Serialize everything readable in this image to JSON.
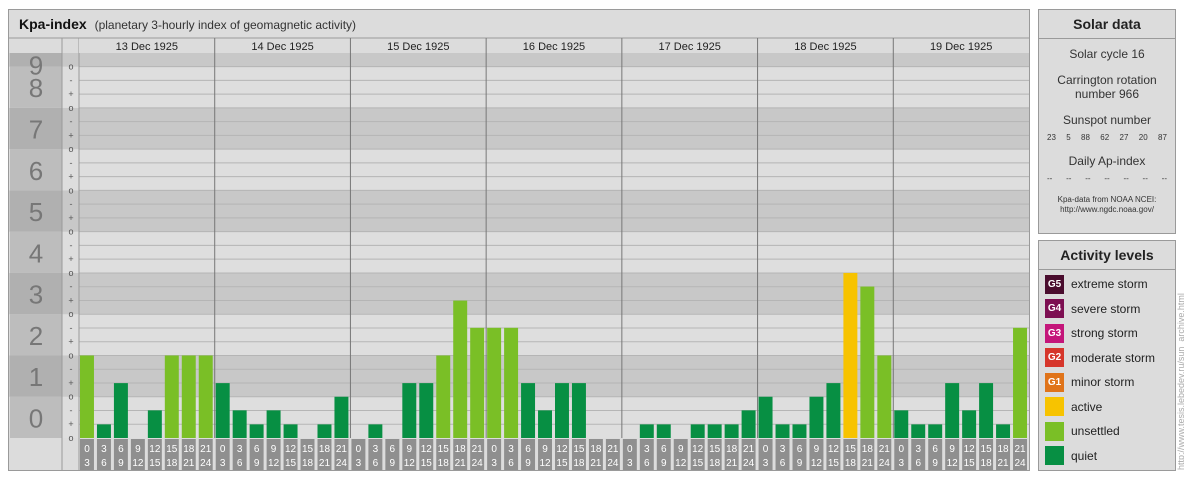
{
  "header": {
    "title": "Kpa-index",
    "subtitle": "(planetary 3-hourly index of geomagnetic activity)"
  },
  "chart_data": {
    "type": "bar",
    "title": "Kpa-index",
    "subtitle": "(planetary 3-hourly index of geomagnetic activity)",
    "days": [
      "13 Dec 1925",
      "14 Dec 1925",
      "15 Dec 1925",
      "16 Dec 1925",
      "17 Dec 1925",
      "18 Dec 1925",
      "19 Dec 1925"
    ],
    "interval_top": [
      "0",
      "3",
      "6",
      "9",
      "12",
      "15",
      "18",
      "21"
    ],
    "interval_bottom": [
      "3",
      "6",
      "9",
      "12",
      "15",
      "18",
      "21",
      "24"
    ],
    "y_major_ticks": [
      "0",
      "1",
      "2",
      "3",
      "4",
      "5",
      "6",
      "7",
      "8",
      "9"
    ],
    "y_minor_ticks": [
      "-",
      "o",
      "+"
    ],
    "ylim": [
      0,
      9.33
    ],
    "values": [
      [
        2.0,
        0.33,
        1.33,
        0.0,
        0.67,
        2.0,
        2.0,
        2.0
      ],
      [
        1.33,
        0.67,
        0.33,
        0.67,
        0.33,
        0.0,
        0.33,
        1.0
      ],
      [
        0.0,
        0.33,
        0.0,
        1.33,
        1.33,
        2.0,
        3.33,
        2.67
      ],
      [
        2.67,
        2.67,
        1.33,
        0.67,
        1.33,
        1.33,
        0.0,
        0.0
      ],
      [
        0.0,
        0.33,
        0.33,
        0.0,
        0.33,
        0.33,
        0.33,
        0.67
      ],
      [
        1.0,
        0.33,
        0.33,
        1.0,
        1.33,
        4.0,
        3.67,
        2.0
      ],
      [
        0.67,
        0.33,
        0.33,
        1.33,
        0.67,
        1.33,
        0.33,
        2.67
      ]
    ],
    "grid": true
  },
  "solar": {
    "heading": "Solar data",
    "cycle": "Solar cycle 16",
    "carrington_line1": "Carrington rotation",
    "carrington_line2": "number 966",
    "sunspot_label": "Sunspot number",
    "sunspots": [
      "23",
      "5",
      "88",
      "62",
      "27",
      "20",
      "87"
    ],
    "ap_label": "Daily Ap-index",
    "ap_values": [
      "--",
      "--",
      "--",
      "--",
      "--",
      "--",
      "--"
    ],
    "source_line1": "Kpa-data from NOAA NCEI:",
    "source_line2": "http://www.ngdc.noaa.gov/"
  },
  "activity": {
    "heading": "Activity levels",
    "levels": [
      {
        "code": "G5",
        "label": "extreme storm",
        "color": "#4a0d2e"
      },
      {
        "code": "G4",
        "label": "severe storm",
        "color": "#7d0f52"
      },
      {
        "code": "G3",
        "label": "strong storm",
        "color": "#c4167a"
      },
      {
        "code": "G2",
        "label": "moderate storm",
        "color": "#d6362b"
      },
      {
        "code": "G1",
        "label": "minor storm",
        "color": "#e0741a"
      },
      {
        "code": "",
        "label": "active",
        "color": "#f7c300"
      },
      {
        "code": "",
        "label": "unsettled",
        "color": "#7abf26"
      },
      {
        "code": "",
        "label": "quiet",
        "color": "#078f43"
      }
    ]
  },
  "watermark": "http://www.tesis.lebedev.ru/sun_archive.html"
}
